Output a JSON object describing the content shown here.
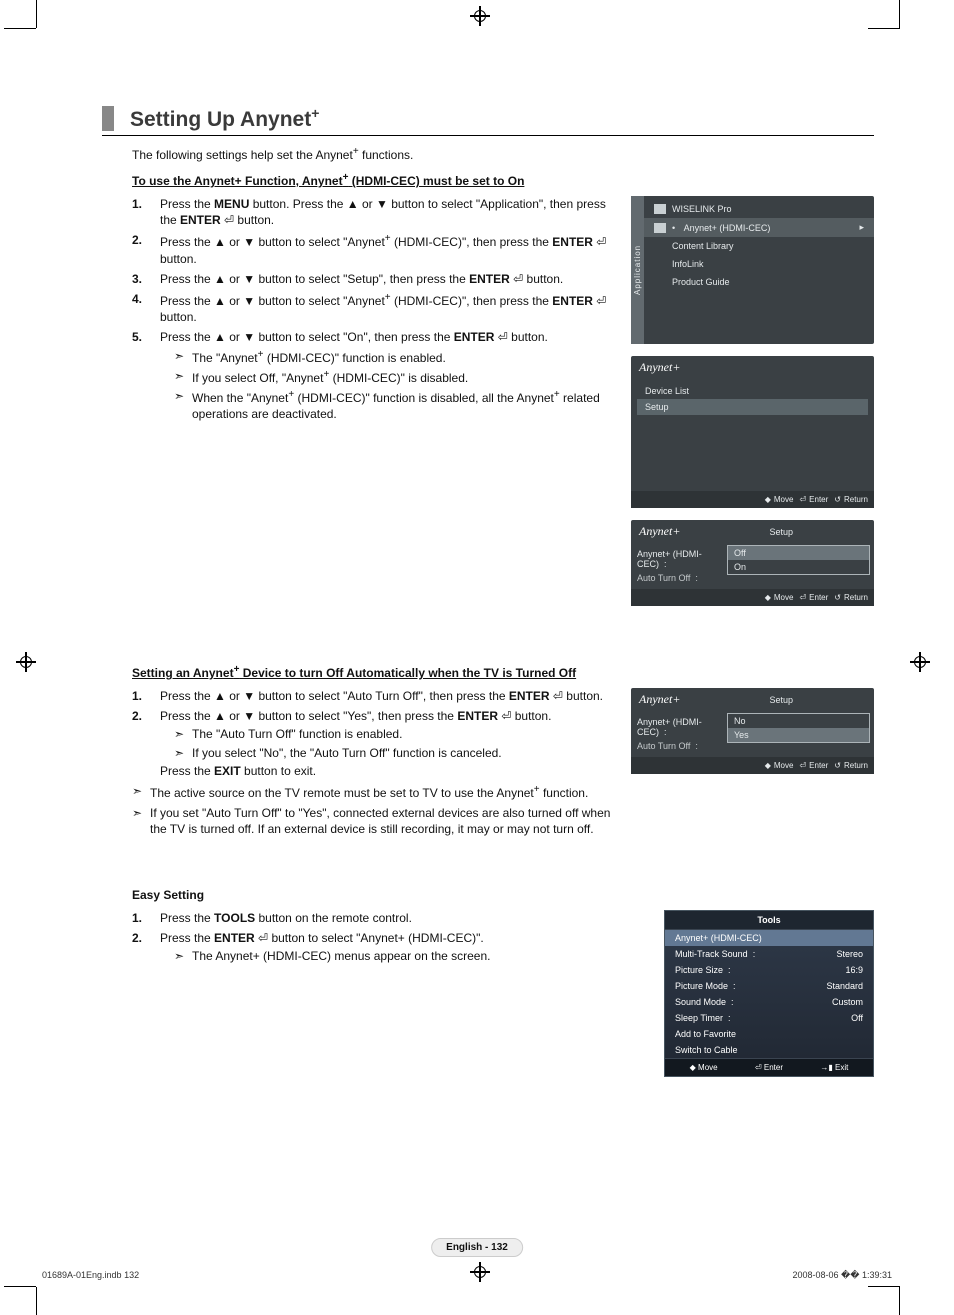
{
  "page": {
    "title_prefix": "Setting Up Anynet",
    "title_sup": "+",
    "intro_a": "The following settings help set the Anynet",
    "intro_b": " functions.",
    "footer_page_label": "English - 132",
    "footer_left": "01689A-01Eng.indb   132",
    "footer_right": "2008-08-06   �� 1:39:31"
  },
  "section1": {
    "heading_a": "To use the Anynet+ Function, Anynet",
    "heading_b": " (HDMI-CEC) must be set to On",
    "steps": [
      {
        "num": "1.",
        "html": "Press the <b>MENU</b> button. Press the ▲ or ▼ button to select \"Application\", then press the <b>ENTER</b> <span class='enter-glyph'>⏎</span> button."
      },
      {
        "num": "2.",
        "html": "Press the ▲ or ▼ button to select \"Anynet<sup>+</sup> (HDMI-CEC)\", then press the <b>ENTER</b> <span class='enter-glyph'>⏎</span> button."
      },
      {
        "num": "3.",
        "html": "Press the ▲ or ▼ button to select \"Setup\", then press the <b>ENTER</b> <span class='enter-glyph'>⏎</span> button."
      },
      {
        "num": "4.",
        "html": "Press the ▲ or ▼ button to select \"Anynet<sup>+</sup> (HDMI-CEC)\", then press the <b>ENTER</b> <span class='enter-glyph'>⏎</span> button."
      },
      {
        "num": "5.",
        "html": "Press the ▲ or ▼ button to select \"On\", then press the <b>ENTER</b> <span class='enter-glyph'>⏎</span> button."
      }
    ],
    "subs": [
      "The \"Anynet+ (HDMI-CEC)\" function is enabled.",
      "If you select Off, \"Anynet+ (HDMI-CEC)\" is disabled.",
      "When the \"Anynet+ (HDMI-CEC)\" function is disabled, all the Anynet+ related operations are deactivated."
    ]
  },
  "section2": {
    "heading_a": "Setting an Anynet",
    "heading_b": " Device to turn Off Automatically when the TV is Turned Off",
    "steps": [
      {
        "num": "1.",
        "html": "Press the ▲ or ▼ button to select \"Auto Turn Off\", then press the <b>ENTER</b> <span class='enter-glyph'>⏎</span> button."
      },
      {
        "num": "2.",
        "html": "Press the ▲ or ▼ button to select \"Yes\", then press the <b>ENTER</b> <span class='enter-glyph'>⏎</span> button."
      }
    ],
    "subs": [
      "The \"Auto Turn Off\" function is enabled.",
      "If you select \"No\", the \"Auto Turn Off\" function is canceled."
    ],
    "exit_line": "Press the <b>EXIT</b> button to exit.",
    "notes": [
      "The active source on the TV remote must be set to TV to use the Anynet+ function.",
      "If you set \"Auto Turn Off\" to \"Yes\", connected external devices are also turned off when the TV is turned off. If an external device is still recording, it may or may not turn off."
    ]
  },
  "section3": {
    "heading": "Easy Setting",
    "steps": [
      {
        "num": "1.",
        "html": "Press the <b>TOOLS</b> button on the remote control."
      },
      {
        "num": "2.",
        "html": "Press the <b>ENTER</b> <span class='enter-glyph'>⏎</span> button to select \"Anynet+ (HDMI-CEC)\"."
      }
    ],
    "sub": "The Anynet+ (HDMI-CEC) menus appear on the screen."
  },
  "osd_app": {
    "tab": "Application",
    "items": [
      "WISELINK Pro",
      "Anynet+ (HDMI-CEC)",
      "Content Library",
      "InfoLink",
      "Product Guide"
    ],
    "selected_index": 1
  },
  "osd_list": {
    "brand": "Anynet+",
    "items": [
      "Device List",
      "Setup"
    ],
    "selected_index": 1,
    "footer": {
      "move": "Move",
      "enter": "Enter",
      "return": "Return"
    }
  },
  "osd_setup1": {
    "brand": "Anynet+",
    "title": "Setup",
    "left": [
      "Anynet+ (HDMI-CEC)",
      "Auto Turn Off"
    ],
    "options": [
      "Off",
      "On"
    ],
    "selected_option": 0,
    "footer": {
      "move": "Move",
      "enter": "Enter",
      "return": "Return"
    }
  },
  "osd_setup2": {
    "brand": "Anynet+",
    "title": "Setup",
    "left": [
      "Anynet+ (HDMI-CEC)",
      "Auto Turn Off"
    ],
    "options": [
      "No",
      "Yes"
    ],
    "selected_option": 1,
    "footer": {
      "move": "Move",
      "enter": "Enter",
      "return": "Return"
    }
  },
  "tools": {
    "title": "Tools",
    "rows": [
      {
        "label": "Anynet+ (HDMI-CEC)",
        "value": "",
        "sel": true
      },
      {
        "label": "Multi-Track Sound",
        "value": "Stereo"
      },
      {
        "label": "Picture Size",
        "value": "16:9"
      },
      {
        "label": "Picture Mode",
        "value": "Standard"
      },
      {
        "label": "Sound Mode",
        "value": "Custom"
      },
      {
        "label": "Sleep Timer",
        "value": "Off"
      },
      {
        "label": "Add to Favorite",
        "value": ""
      },
      {
        "label": "Switch to Cable",
        "value": ""
      }
    ],
    "footer": {
      "move": "Move",
      "enter": "Enter",
      "exit": "Exit"
    }
  }
}
